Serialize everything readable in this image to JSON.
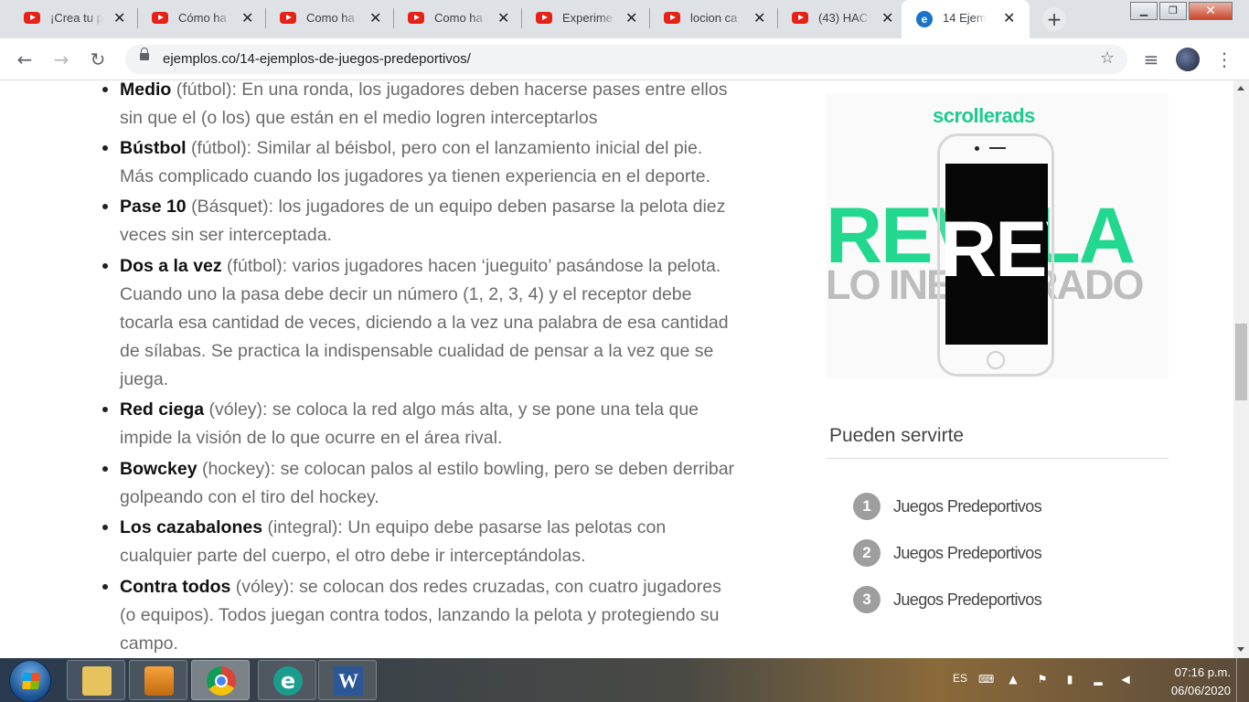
{
  "browser": {
    "tabs": [
      {
        "title": "¡Crea tu p",
        "icon": "youtube-icon"
      },
      {
        "title": "Cómo ha",
        "icon": "youtube-icon"
      },
      {
        "title": "Como ha",
        "icon": "youtube-icon"
      },
      {
        "title": "Como ha",
        "icon": "youtube-icon"
      },
      {
        "title": "Experime",
        "icon": "youtube-icon"
      },
      {
        "title": "locion ca",
        "icon": "youtube-icon"
      },
      {
        "title": "(43) HAC",
        "icon": "youtube-icon"
      },
      {
        "title": "14 Ejemp",
        "icon": "ejemplos-icon",
        "active": true
      }
    ],
    "close_glyph": "✕",
    "new_tab_glyph": "+",
    "url": "ejemplos.co/14-ejemplos-de-juegos-predeportivos/",
    "window": {
      "minimize": "▁",
      "maximize": "❐",
      "close": "✕"
    },
    "nav": {
      "back": "←",
      "forward": "→",
      "reload": "↻",
      "star": "☆",
      "media": "≡",
      "menu": "⋮"
    }
  },
  "article": {
    "items": [
      {
        "name": "Medio",
        "text": " (fútbol): En una ronda, los jugadores deben hacerse pases entre ellos sin que el (o los) que están en el medio logren interceptarlos"
      },
      {
        "name": "Bústbol",
        "text": " (fútbol): Similar al béisbol, pero con el lanzamiento inicial del pie. Más complicado cuando los jugadores ya tienen experiencia en el deporte."
      },
      {
        "name": "Pase 10",
        "text": " (Básquet): los jugadores de un equipo deben pasarse la pelota diez veces sin ser interceptada."
      },
      {
        "name": "Dos a la vez",
        "text": " (fútbol): varios jugadores hacen ‘jueguito’ pasándose la pelota. Cuando uno la pasa debe decir un número (1, 2, 3, 4) y el receptor debe tocarla esa cantidad de veces, diciendo a la vez una palabra de esa cantidad de sílabas. Se practica la indispensable cualidad de pensar a la vez que se juega."
      },
      {
        "name": "Red ciega",
        "text": " (vóley): se coloca la red algo más alta, y se pone una tela que impide la visión de lo que ocurre en el área rival."
      },
      {
        "name": "Bowckey",
        "text": " (hockey): se colocan palos al estilo bowling, pero se deben derribar golpeando con el tiro del hockey."
      },
      {
        "name": "Los cazabalones",
        "text": " (integral): Un equipo debe pasarse las pelotas con cualquier parte del cuerpo, el otro debe ir interceptándolas."
      },
      {
        "name": "Contra todos",
        "text": " (vóley): se colocan dos redes cruzadas, con cuatro jugadores (o equipos). Todos juegan contra todos, lanzando la pelota y protegiendo su campo."
      }
    ]
  },
  "ad": {
    "brand": "scrollerads",
    "headline": "REVELA",
    "subline": "LO INESPERADO",
    "accent": "#22d88e"
  },
  "related": {
    "title": "Pueden servirte",
    "items": [
      {
        "num": "1",
        "label": "Juegos Predeportivos"
      },
      {
        "num": "2",
        "label": "Juegos Predeportivos"
      },
      {
        "num": "3",
        "label": "Juegos Predeportivos"
      }
    ]
  },
  "taskbar": {
    "apps": [
      {
        "name": "explorer",
        "icon": "folder-icon"
      },
      {
        "name": "media-player",
        "icon": "media-player-icon"
      },
      {
        "name": "chrome",
        "icon": "chrome-icon"
      },
      {
        "name": "edge",
        "icon": "edge-icon",
        "glyph": "e"
      },
      {
        "name": "word",
        "icon": "word-icon",
        "glyph": "W"
      }
    ],
    "lang": "ES",
    "time": "07:16 p.m.",
    "date": "06/06/2020"
  }
}
